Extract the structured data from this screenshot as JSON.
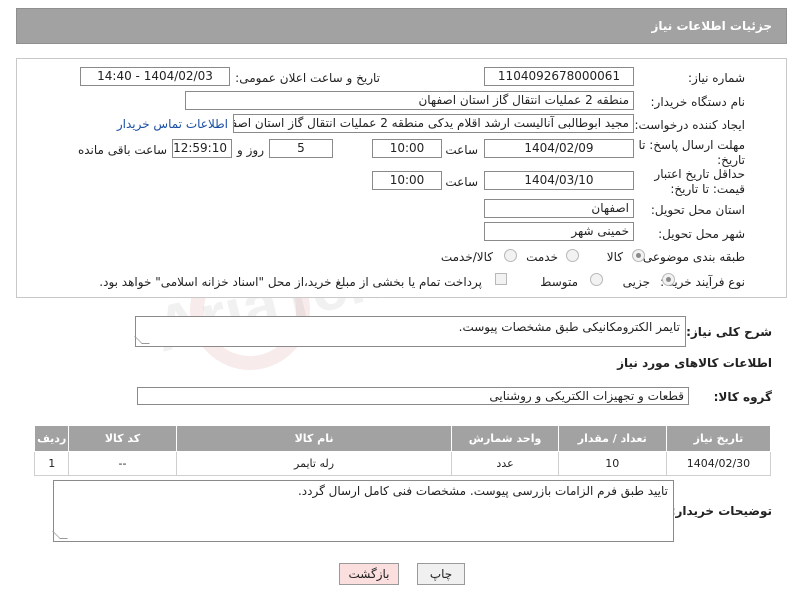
{
  "header": {
    "title": "جزئیات اطلاعات نیاز"
  },
  "form": {
    "need_number_label": "شماره نیاز:",
    "need_number": "1104092678000061",
    "announce_label": "تاریخ و ساعت اعلان عمومی:",
    "announce_value": "1404/02/03 - 14:40",
    "buyer_org_label": "نام دستگاه خریدار:",
    "buyer_org": "منطقه 2 عملیات انتقال گاز استان اصفهان",
    "requester_label": "ایجاد کننده درخواست:",
    "requester": "مجید ابوطالبی آنالیست ارشد اقلام یدکی منطقه 2 عملیات انتقال گاز استان اصفهان",
    "buyer_contact_link": "اطلاعات تماس خریدار",
    "deadline_label": "مهلت ارسال پاسخ: تا تاریخ:",
    "deadline_date": "1404/02/09",
    "time_label": "ساعت",
    "deadline_time": "10:00",
    "days_value": "5",
    "days_label": "روز و",
    "remaining_time": "12:59:10",
    "remaining_label": "ساعت باقی مانده",
    "price_validity_label": "حداقل تاریخ اعتبار قیمت: تا تاریخ:",
    "price_validity_date": "1404/03/10",
    "price_validity_time": "10:00",
    "province_label": "استان محل تحویل:",
    "province": "اصفهان",
    "city_label": "شهر محل تحویل:",
    "city": "خمینی شهر",
    "category_label": "طبقه بندی موضوعی:",
    "category_options": [
      "کالا",
      "خدمت",
      "کالا/خدمت"
    ],
    "process_label": "نوع فرآیند خرید :",
    "process_options": [
      "جزیی",
      "متوسط"
    ],
    "payment_note": "پرداخت تمام یا بخشی از مبلغ خرید،از محل \"اسناد خزانه اسلامی\" خواهد بود."
  },
  "summary": {
    "label": "شرح کلی نیاز:",
    "value": "تایمر الکترومکانیکی طبق مشخصات پیوست."
  },
  "goods": {
    "section_title": "اطلاعات کالاهای مورد نیاز",
    "group_label": "گروه کالا:",
    "group_value": "قطعات و تجهیزات الکتریکی و روشنایی",
    "columns": [
      "ردیف",
      "کد کالا",
      "نام کالا",
      "واحد شمارش",
      "تعداد / مقدار",
      "تاریخ نیاز"
    ],
    "rows": [
      {
        "row": "1",
        "code": "--",
        "name": "رله تایمر",
        "unit": "عدد",
        "qty": "10",
        "date": "1404/02/30"
      }
    ]
  },
  "buyer_notes": {
    "label": "توضیحات خریدار:",
    "value": "تایید طبق فرم الزامات بازرسی پیوست. مشخصات فنی کامل ارسال گردد."
  },
  "buttons": {
    "print": "چاپ",
    "back": "بازگشت"
  },
  "watermark": "AriaTender.net"
}
